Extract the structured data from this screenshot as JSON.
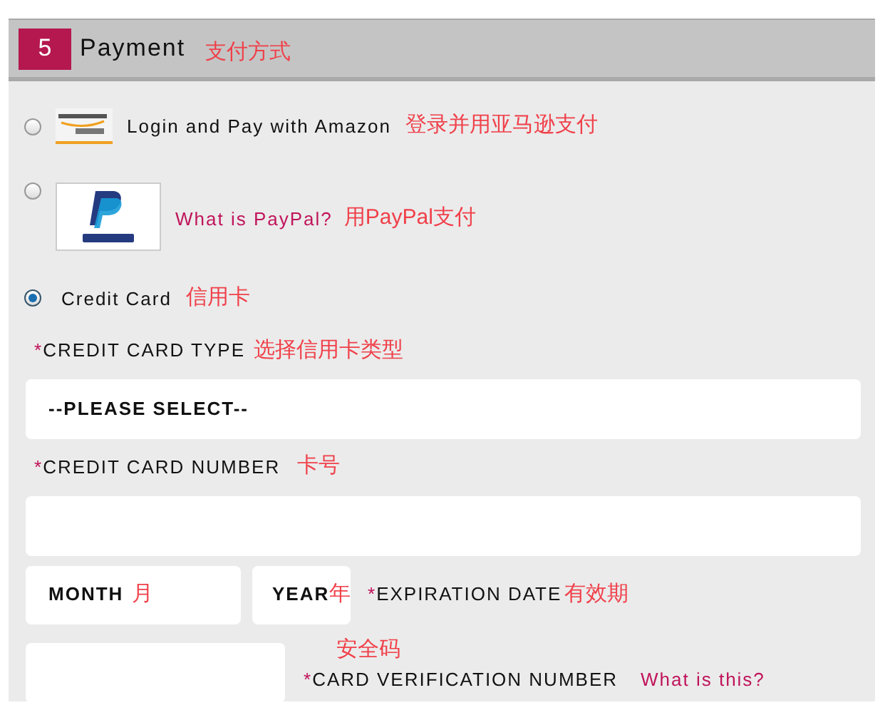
{
  "section": {
    "number": "5",
    "title": "Payment",
    "annotation": "支付方式"
  },
  "options": [
    {
      "kind": "amazon",
      "selected": false,
      "label": "Login and Pay with Amazon",
      "annotation": "登录并用亚马逊支付"
    },
    {
      "kind": "paypal",
      "selected": false,
      "link": "What is PayPal?",
      "annotation": "用PayPal支付"
    },
    {
      "kind": "card",
      "selected": true,
      "label": "Credit Card",
      "annotation": "信用卡"
    }
  ],
  "card_type": {
    "mark": "*",
    "label": "CREDIT CARD TYPE",
    "annotation": "选择信用卡类型",
    "value": "--PLEASE SELECT--"
  },
  "card_number": {
    "mark": "*",
    "label": "CREDIT CARD NUMBER",
    "annotation": "卡号"
  },
  "expiration": {
    "month": "MONTH",
    "month_annotation": "月",
    "year": "YEAR",
    "year_annotation": "年",
    "mark": "*",
    "label": "EXPIRATION DATE",
    "annotation": "有效期"
  },
  "verification": {
    "annotation": "安全码",
    "mark": "*",
    "label": "CARD VERIFICATION NUMBER",
    "link": "What is this?"
  }
}
